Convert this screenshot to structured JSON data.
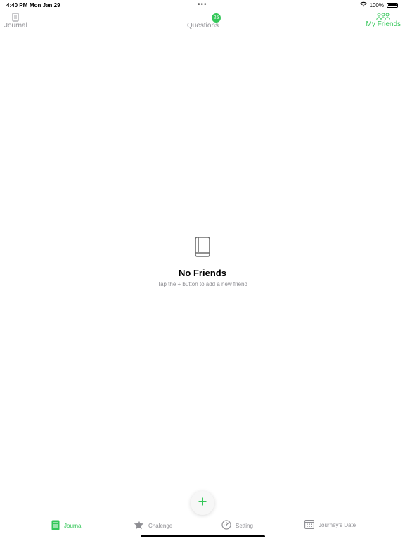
{
  "status_bar": {
    "time": "4:40 PM",
    "date": "Mon Jan 29",
    "dots": "•••",
    "battery_percent": "100%",
    "battery_level": 1.0
  },
  "top_tabs": {
    "journal": {
      "label": "Journal",
      "icon": "notebook-icon"
    },
    "questions": {
      "label": "Questions",
      "badge": "25"
    },
    "friends": {
      "label": "My Friends",
      "icon": "people-icon"
    }
  },
  "empty_state": {
    "icon": "book-icon",
    "title": "No Friends",
    "subtitle": "Tap the + button to add a new friend"
  },
  "fab": {
    "icon": "plus-icon"
  },
  "bottom_tabs": [
    {
      "label": "Journal",
      "icon": "journal-icon"
    },
    {
      "label": "Chalenge",
      "icon": "star-icon"
    },
    {
      "label": "Setting",
      "icon": "gauge-icon"
    },
    {
      "label": "Journey's Date",
      "icon": "calendar-icon"
    }
  ],
  "colors": {
    "accent": "#34c759",
    "inactive": "#8e8e93",
    "background": "#ffffff"
  }
}
